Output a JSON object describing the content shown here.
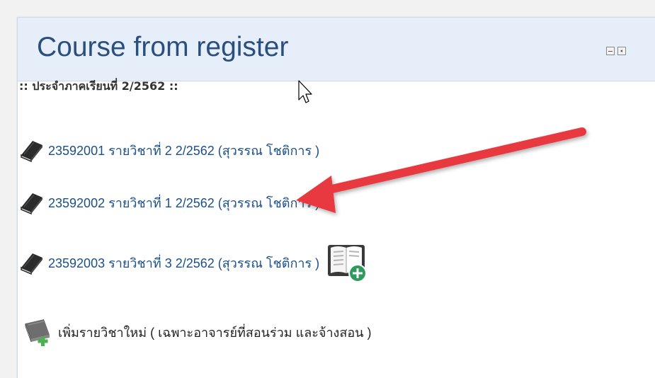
{
  "block": {
    "title": "Course from register",
    "controls": [
      "minimize-icon",
      "dock-icon"
    ]
  },
  "semester_label": ":: ประจำภาคเรียนที่ 2/2562 ::",
  "courses": [
    {
      "label": "23592001 รายวิชาที่ 2 2/2562 (สุวรรณ โชติการ )",
      "icon": "book-icon"
    },
    {
      "label": "23592002 รายวิชาที่ 1 2/2562 (สุวรรณ โชติการ )",
      "icon": "book-icon"
    },
    {
      "label": "23592003 รายวิชาที่ 3 2/2562 (สุวรรณ โชติการ )",
      "icon": "book-icon",
      "extra_icon": "add-book-icon"
    }
  ],
  "add_course": {
    "label": "เพิ่มรายวิชาใหม่ ( เฉพาะอาจารย์ที่สอนร่วม และจ้างสอน )",
    "icon": "add-course-icon"
  },
  "annotation": {
    "arrow_color": "#e8393f"
  }
}
